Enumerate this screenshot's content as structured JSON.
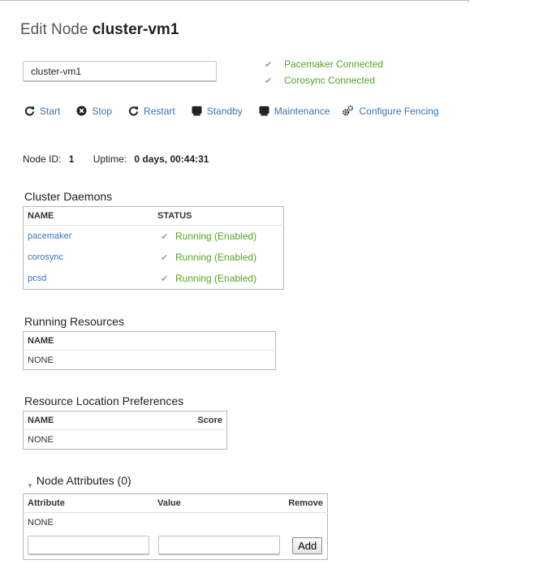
{
  "header": {
    "title_prefix": "Edit Node",
    "node_name": "cluster-vm1"
  },
  "name_field": {
    "value": "cluster-vm1"
  },
  "statuses": [
    {
      "text": "Pacemaker Connected"
    },
    {
      "text": "Corosync Connected"
    }
  ],
  "actions": {
    "start": "Start",
    "stop": "Stop",
    "restart": "Restart",
    "standby": "Standby",
    "maintenance": "Maintenance",
    "fencing": "Configure Fencing"
  },
  "info": {
    "node_id_label": "Node ID:",
    "node_id": "1",
    "uptime_label": "Uptime:",
    "uptime": "0 days, 00:44:31"
  },
  "daemons": {
    "title": "Cluster Daemons",
    "headers": [
      "NAME",
      "STATUS"
    ],
    "rows": [
      {
        "name": "pacemaker",
        "status": "Running (Enabled)"
      },
      {
        "name": "corosync",
        "status": "Running (Enabled)"
      },
      {
        "name": "pcsd",
        "status": "Running (Enabled)"
      }
    ]
  },
  "resources": {
    "title": "Running Resources",
    "header": "NAME",
    "empty": "NONE"
  },
  "preferences": {
    "title": "Resource Location Preferences",
    "headers": [
      "NAME",
      "Score"
    ],
    "empty": "NONE"
  },
  "attributes": {
    "title": "Node Attributes (0)",
    "headers": [
      "Attribute",
      "Value",
      "Remove"
    ],
    "empty": "NONE",
    "add_label": "Add"
  },
  "colors": {
    "link": "#3a74b8",
    "success": "#54a420"
  }
}
